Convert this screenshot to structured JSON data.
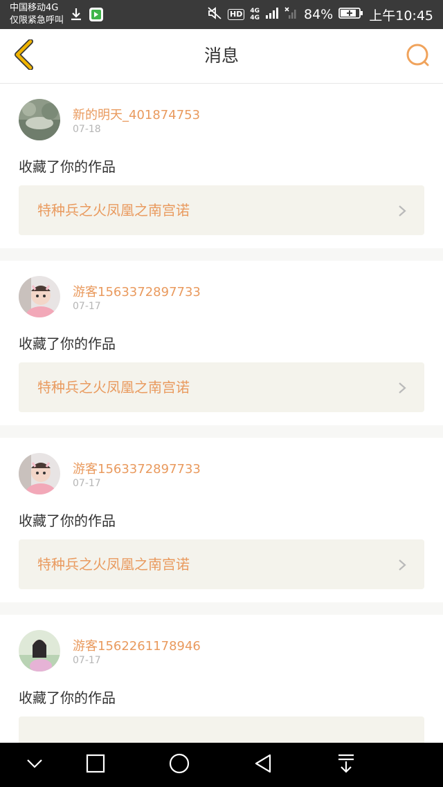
{
  "status_bar": {
    "carrier": "中国移动4G",
    "emergency": "仅限紧急呼叫",
    "hd": "HD",
    "net_top": "4G",
    "net_bottom": "4G",
    "battery": "84%",
    "time": "上午10:45"
  },
  "header": {
    "title": "消息",
    "back_icon": "chevron-left-icon",
    "search_icon": "search-icon"
  },
  "messages": [
    {
      "user": "新的明天_401874753",
      "date": "07-18",
      "action": "收藏了你的作品",
      "work": "特种兵之火凤凰之南宫诺"
    },
    {
      "user": "游客1563372897733",
      "date": "07-17",
      "action": "收藏了你的作品",
      "work": "特种兵之火凤凰之南宫诺"
    },
    {
      "user": "游客1563372897733",
      "date": "07-17",
      "action": "收藏了你的作品",
      "work": "特种兵之火凤凰之南宫诺"
    },
    {
      "user": "游客1562261178946",
      "date": "07-17",
      "action": "收藏了你的作品",
      "work": ""
    }
  ],
  "colors": {
    "accent": "#e99a5e",
    "back_arrow": "#f0b400",
    "work_bg": "#f4f3ec",
    "status_bg": "#3a3a3a"
  },
  "nav_bar": {
    "icons": [
      "chevron-down-icon",
      "square-icon",
      "circle-icon",
      "triangle-back-icon",
      "pulldown-icon"
    ]
  }
}
